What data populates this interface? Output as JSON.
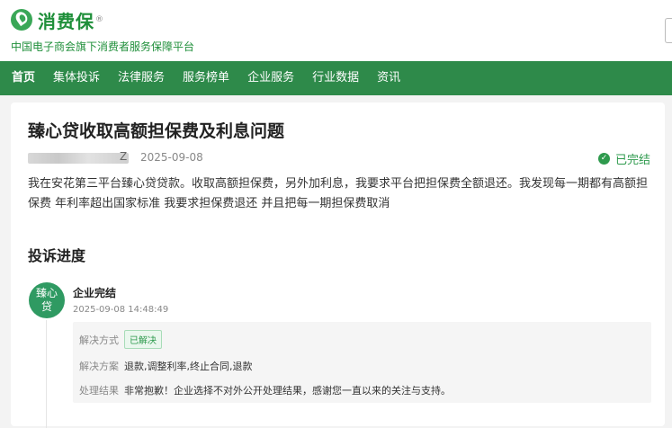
{
  "header": {
    "logo_text": "消费保",
    "logo_reg": "®",
    "slogan": "中国电子商会旗下消费者服务保障平台"
  },
  "nav": {
    "items": [
      "首页",
      "集体投诉",
      "法律服务",
      "服务榜单",
      "企业服务",
      "行业数据",
      "资讯"
    ]
  },
  "complaint": {
    "title": "臻心贷收取高额担保费及利息问题",
    "user_suffix": "Z",
    "date": "2025-09-08",
    "status": "已完结",
    "description": "我在安花第三平台臻心贷贷款。收取高额担保费，另外加利息，我要求平台把担保费全额退还。我发现每一期都有高额担保费 年利率超出国家标准 我要求担保费退还 并且把每一期担保费取消"
  },
  "progress": {
    "section_title": "投诉进度",
    "avatar_text": "臻心贷",
    "event_title": "企业完结",
    "event_time": "2025-09-08 14:48:49",
    "resolution_method_label": "解决方式",
    "resolution_method_value": "已解决",
    "resolution_plan_label": "解决方案",
    "resolution_plan_value": "退款,调整利率,终止合同,退款",
    "result_label": "处理结果",
    "result_value": "非常抱歉！企业选择不对外公开处理结果，感谢您一直以来的关注与支持。"
  },
  "colors": {
    "brand_green": "#2e8a4a",
    "status_green": "#2e9a4d"
  }
}
